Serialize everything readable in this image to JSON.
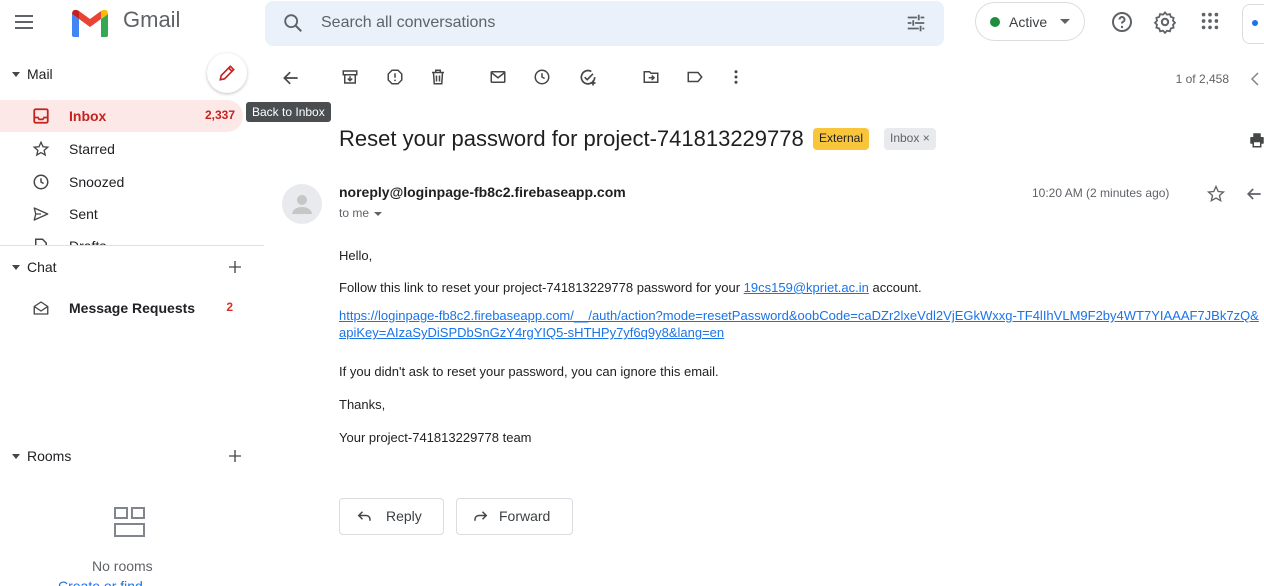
{
  "header": {
    "app_name": "Gmail",
    "search_placeholder": "Search all conversations",
    "status_label": "Active",
    "status_color": "#1e8e3e",
    "icons": [
      "hamburger-icon",
      "gmail-logo",
      "search-icon",
      "search-options-icon",
      "help-icon",
      "settings-icon",
      "apps-icon"
    ]
  },
  "sidebar": {
    "mail_section": "Mail",
    "items": [
      {
        "label": "Inbox",
        "count": "2,337",
        "icon": "inbox-icon"
      },
      {
        "label": "Starred",
        "count": "",
        "icon": "star-icon"
      },
      {
        "label": "Snoozed",
        "count": "",
        "icon": "clock-icon"
      },
      {
        "label": "Sent",
        "count": "",
        "icon": "send-icon"
      },
      {
        "label": "Drafts",
        "count": "",
        "icon": "draft-icon"
      }
    ],
    "chat_section": "Chat",
    "chat_items": [
      {
        "label": "Message Requests",
        "count": "2",
        "icon": "message-requests-icon"
      }
    ],
    "rooms_section": "Rooms",
    "rooms_empty": "No rooms",
    "rooms_create": "Create or find"
  },
  "toolbar": {
    "tooltip": "Back to Inbox",
    "pagination": "1 of 2,458",
    "icons": [
      "back-icon",
      "archive-icon",
      "report-spam-icon",
      "delete-icon",
      "mark-unread-icon",
      "snooze-icon",
      "add-task-icon",
      "move-to-icon",
      "label-icon",
      "more-icon"
    ]
  },
  "message": {
    "subject": "Reset your password for project-741813229778",
    "labels": {
      "external": "External",
      "inbox": "Inbox ×"
    },
    "sender": "noreply@loginpage-fb8c2.firebaseapp.com",
    "to": "to me",
    "time": "10:20 AM (2 minutes ago)",
    "body": {
      "greeting": "Hello,",
      "line1_prefix": "Follow this link to reset your project-741813229778 password for your ",
      "line1_email": "19cs159@kpriet.ac.in",
      "line1_suffix": " account.",
      "link": "https://loginpage-fb8c2.firebaseapp.com/__/auth/action?mode=resetPassword&oobCode=caDZr2lxeVdl2VjEGkWxxg-TF4lIhVLM9F2by4WT7YIAAAF7JBk7zQ&apiKey=AIzaSyDiSPDbSnGzY4rgYIQ5-sHTHPy7yf6q9y8&lang=en",
      "line3": "If you didn't ask to reset your password, you can ignore this email.",
      "thanks": "Thanks,",
      "signoff": "Your project-741813229778 team"
    },
    "reply_label": "Reply",
    "forward_label": "Forward"
  }
}
